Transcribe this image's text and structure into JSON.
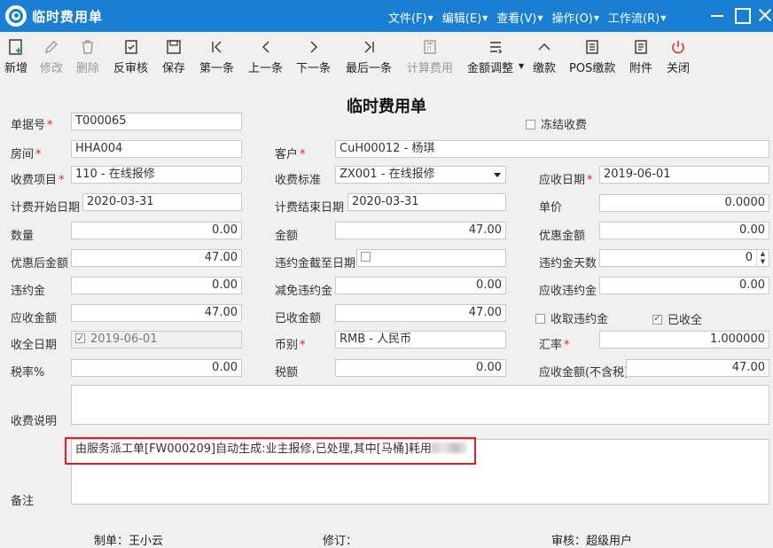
{
  "window": {
    "title": "临时费用单",
    "menus": [
      "文件(F)",
      "编辑(E)",
      "查看(V)",
      "操作(O)",
      "工作流(R)"
    ]
  },
  "toolbar": {
    "new": "新增",
    "edit": "修改",
    "delete": "删除",
    "unapprove": "反审核",
    "save": "保存",
    "first": "第一条",
    "prev": "上一条",
    "next": "下一条",
    "last": "最后一条",
    "calc": "计算费用",
    "adjust": "金额调整",
    "pay": "缴款",
    "pos_pay": "POS缴款",
    "attachment": "附件",
    "close": "关闭"
  },
  "form": {
    "heading": "临时费用单",
    "doc_no": {
      "label": "单据号",
      "value": "T000065"
    },
    "freeze": {
      "label": "冻结收费",
      "checked": false
    },
    "room": {
      "label": "房间",
      "value": "HHA004"
    },
    "customer": {
      "label": "客户",
      "value": "CuH00012 - 杨琪"
    },
    "fee_item": {
      "label": "收费项目",
      "value": "110 - 在线报修"
    },
    "fee_standard": {
      "label": "收费标准",
      "value": "ZX001 - 在线报修"
    },
    "due_date": {
      "label": "应收日期",
      "value": "2019-06-01"
    },
    "start_date": {
      "label": "计费开始日期",
      "value": "2020-03-31"
    },
    "end_date": {
      "label": "计费结束日期",
      "value": "2020-03-31"
    },
    "unit_price": {
      "label": "单价",
      "value": "0.0000"
    },
    "quantity": {
      "label": "数量",
      "value": "0.00"
    },
    "amount": {
      "label": "金额",
      "value": "47.00"
    },
    "discount": {
      "label": "优惠金额",
      "value": "0.00"
    },
    "after_discount": {
      "label": "优惠后金额",
      "value": "47.00"
    },
    "penalty_until": {
      "label": "违约金截至日期",
      "checked": false
    },
    "penalty_days": {
      "label": "违约金天数",
      "value": "0"
    },
    "penalty": {
      "label": "违约金",
      "value": "0.00"
    },
    "penalty_waived": {
      "label": "减免违约金",
      "value": "0.00"
    },
    "penalty_receivable": {
      "label": "应收违约金",
      "value": "0.00"
    },
    "receivable": {
      "label": "应收金额",
      "value": "47.00"
    },
    "received": {
      "label": "已收金额",
      "value": "47.00"
    },
    "collect_penalty": {
      "label": "收取违约金",
      "checked": false
    },
    "fully_received": {
      "label": "已收全",
      "checked": true
    },
    "full_date": {
      "label": "收全日期",
      "value": "2019-06-01",
      "checked": true
    },
    "currency": {
      "label": "币别",
      "value": "RMB - 人民币"
    },
    "rate": {
      "label": "汇率",
      "value": "1.000000"
    },
    "tax_rate": {
      "label": "税率%",
      "value": "0.00"
    },
    "tax": {
      "label": "税额",
      "value": "0.00"
    },
    "receivable_ex_tax": {
      "label": "应收金额(不含税)",
      "value": "47.00"
    },
    "fee_desc": {
      "label": "收费说明",
      "value": ""
    },
    "remark": {
      "label": "备注",
      "value": "由服务派工单[FW000209]自动生成:业主报修,已处理,其中[马桶]耗用"
    }
  },
  "footer": {
    "maker": "制单：王小云",
    "revise": "修订：",
    "auditor": "审核：超级用户"
  },
  "colors": {
    "titlebar": "#1a7fd3",
    "required": "#e02020",
    "highlight": "#e02020"
  }
}
